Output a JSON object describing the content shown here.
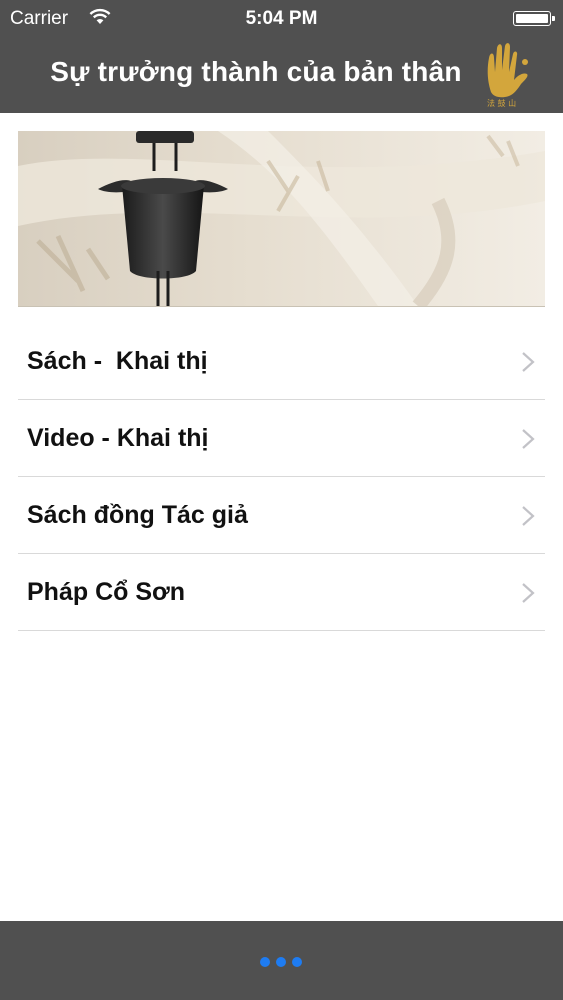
{
  "status_bar": {
    "carrier": "Carrier",
    "time": "5:04 PM"
  },
  "nav": {
    "title": "Sự trưởng thành của bản thân",
    "logo_icon": "hand-logo-icon"
  },
  "menu": {
    "items": [
      {
        "label": "Sách -  Khai thị",
        "icon": "chevron-right-icon"
      },
      {
        "label": "Video - Khai thị",
        "icon": "chevron-right-icon"
      },
      {
        "label": "Sách đồng Tác giả",
        "icon": "chevron-right-icon"
      },
      {
        "label": "Pháp Cổ Sơn",
        "icon": "chevron-right-icon"
      }
    ]
  },
  "tab_bar": {
    "more_icon": "more-dots-icon",
    "accent": "#1e7cf2"
  },
  "colors": {
    "bar": "#505050",
    "background": "#ffffff"
  }
}
